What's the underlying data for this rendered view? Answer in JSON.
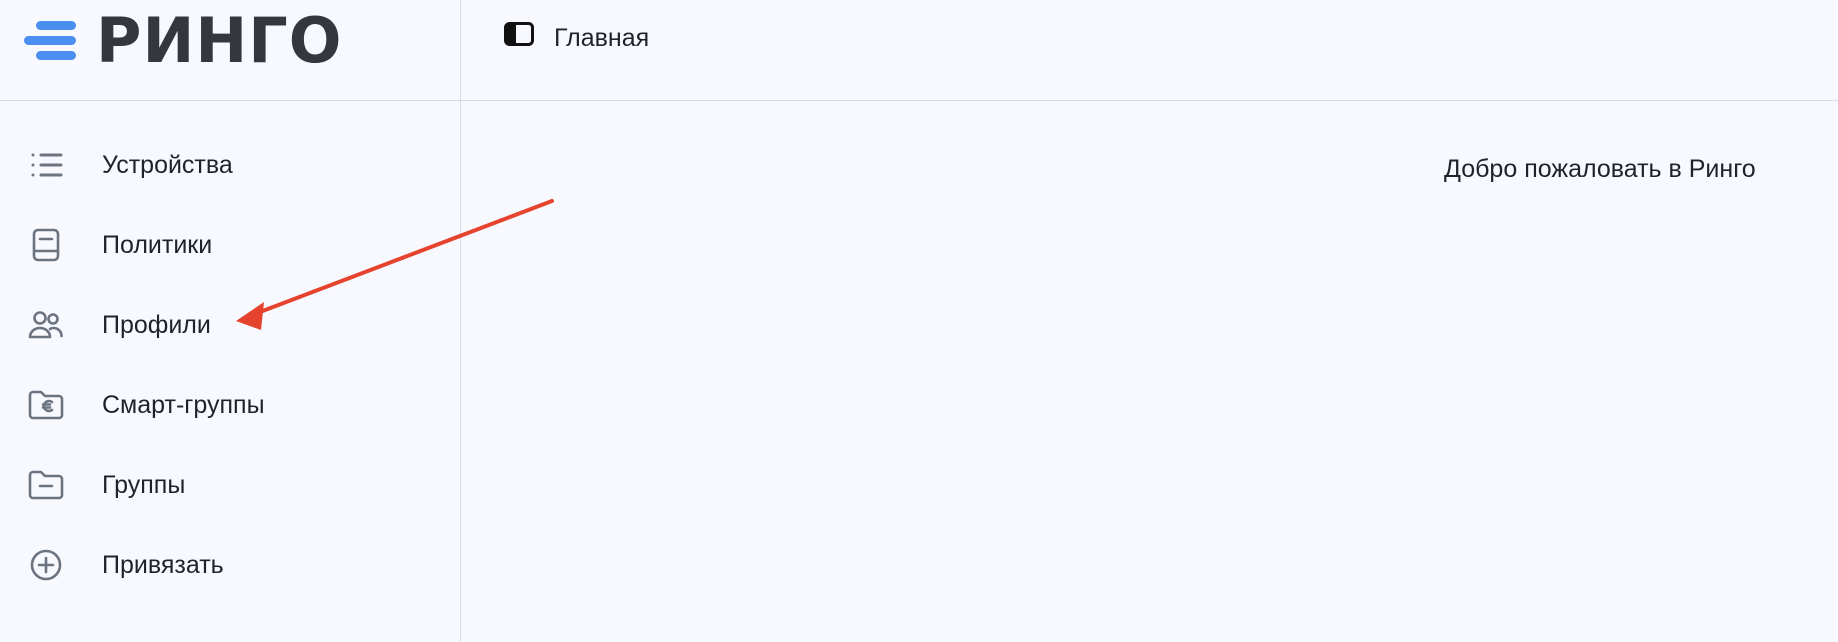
{
  "brand": {
    "logo_text": "РИНГО",
    "accent_color": "#4a8ef0",
    "text_color": "#34373c"
  },
  "header": {
    "toggle_icon": "sidebar-toggle-icon",
    "title": "Главная"
  },
  "sidebar": {
    "items": [
      {
        "label": "Устройства",
        "icon": "list-icon"
      },
      {
        "label": "Политики",
        "icon": "book-icon"
      },
      {
        "label": "Профили",
        "icon": "users-icon"
      },
      {
        "label": "Смарт-группы",
        "icon": "folder-euro-icon"
      },
      {
        "label": "Группы",
        "icon": "folder-minus-icon"
      },
      {
        "label": "Привязать",
        "icon": "plus-circle-icon"
      }
    ]
  },
  "main": {
    "welcome_text": "Добро пожаловать в Ринго"
  },
  "annotation": {
    "arrow_color": "#e5432e"
  }
}
